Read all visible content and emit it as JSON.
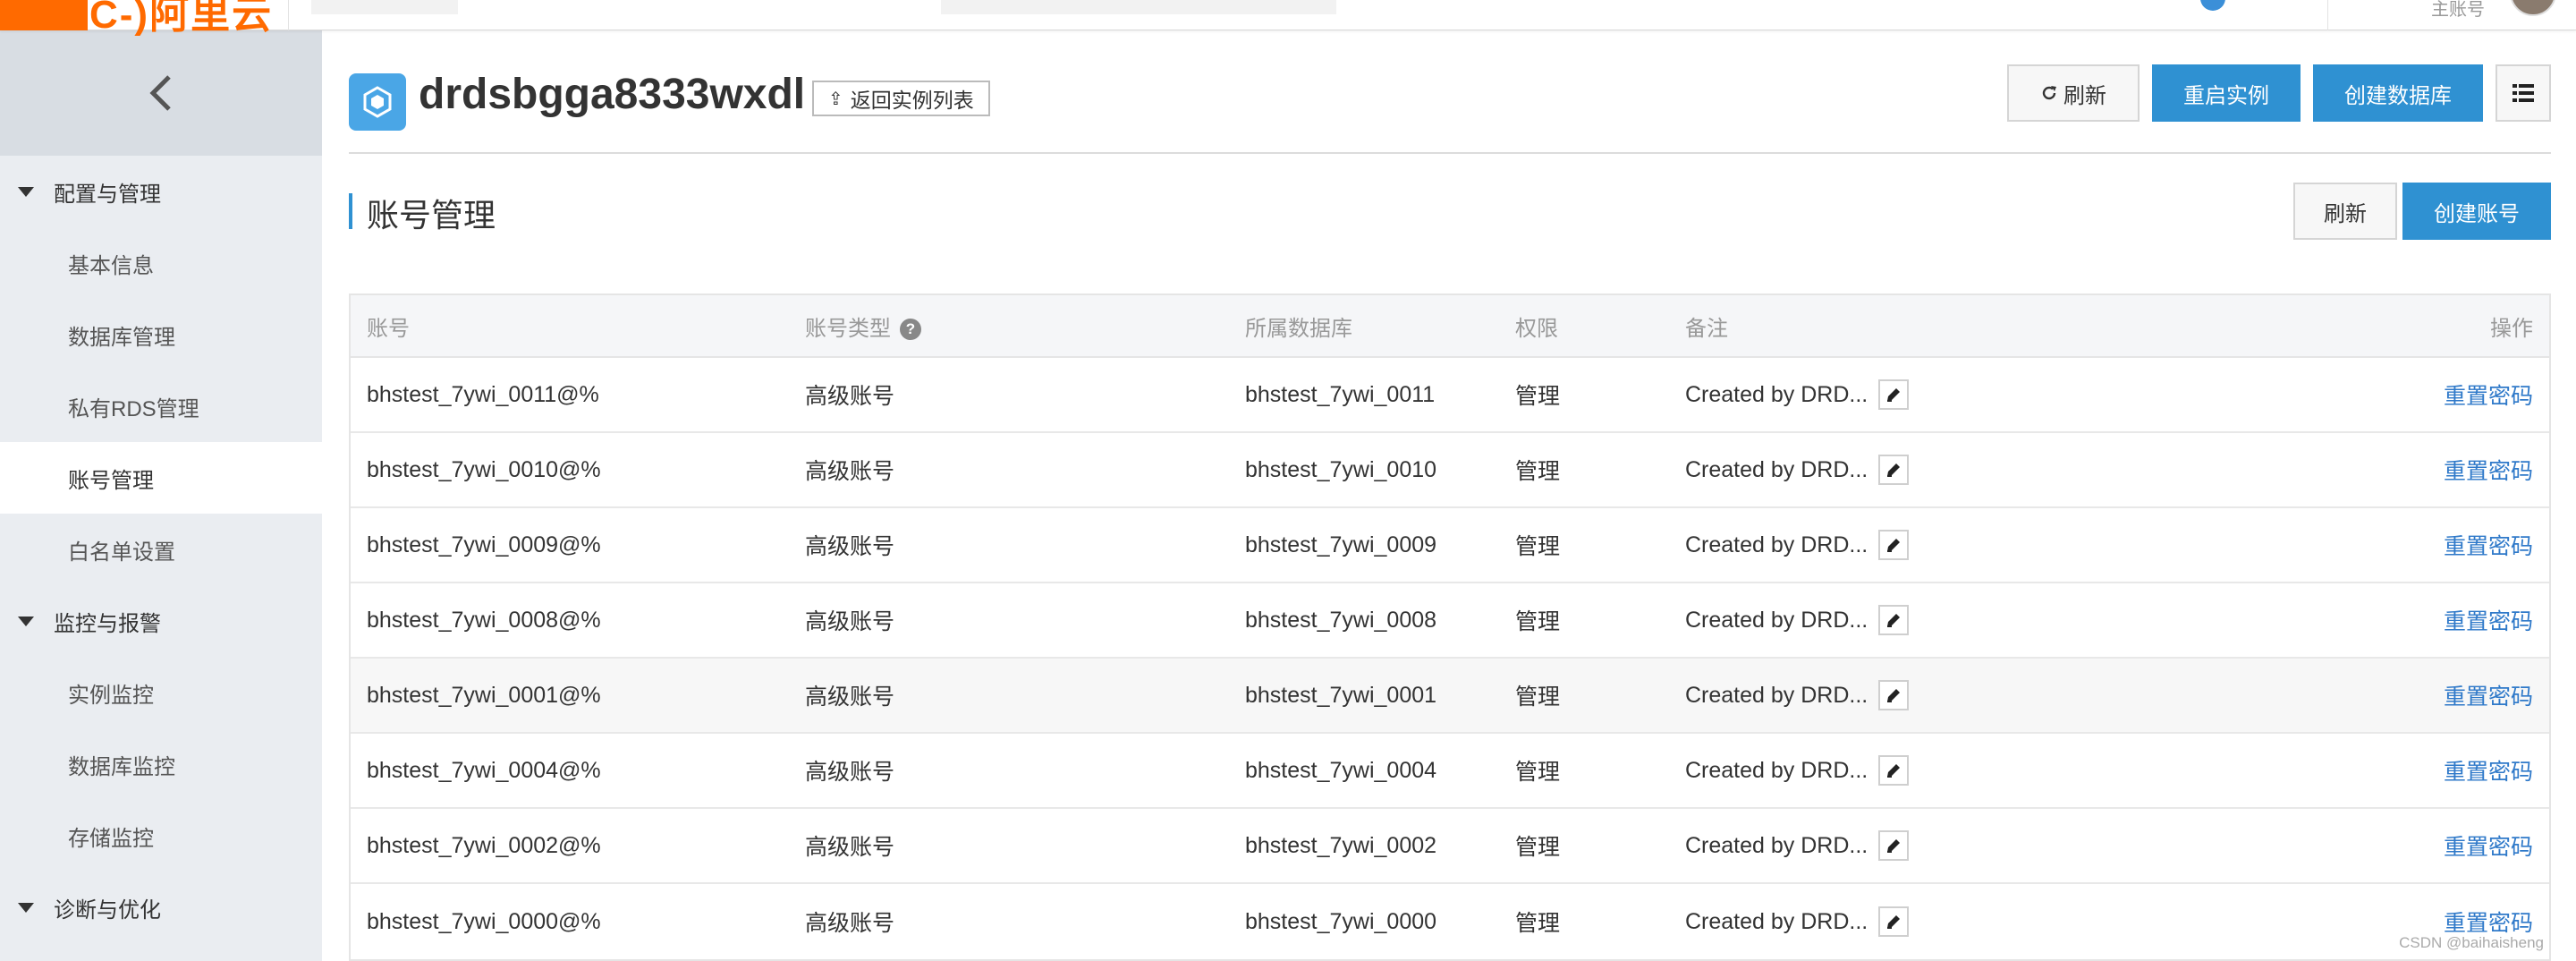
{
  "topbar": {
    "logo_text": "C-)阿里云",
    "user_label": "主账号"
  },
  "sidebar": {
    "collapse_icon": "chevron-left-icon",
    "groups": [
      {
        "label": "配置与管理",
        "items": [
          {
            "label": "基本信息"
          },
          {
            "label": "数据库管理"
          },
          {
            "label": "私有RDS管理"
          },
          {
            "label": "账号管理",
            "active": true
          },
          {
            "label": "白名单设置"
          }
        ]
      },
      {
        "label": "监控与报警",
        "items": [
          {
            "label": "实例监控"
          },
          {
            "label": "数据库监控"
          },
          {
            "label": "存储监控"
          }
        ]
      },
      {
        "label": "诊断与优化",
        "items": []
      }
    ]
  },
  "header": {
    "instance_name": "drdsbgga8333wxdl",
    "back_label": "返回实例列表",
    "refresh_label": "刷新",
    "restart_label": "重启实例",
    "create_db_label": "创建数据库",
    "menu_icon": "list-icon"
  },
  "section": {
    "title": "账号管理",
    "refresh_label": "刷新",
    "create_account_label": "创建账号"
  },
  "table": {
    "columns": {
      "account": "账号",
      "type": "账号类型",
      "db": "所属数据库",
      "perm": "权限",
      "note": "备注",
      "op": "操作"
    },
    "rows": [
      {
        "account": "bhstest_7ywi_0011@%",
        "type": "高级账号",
        "db": "bhstest_7ywi_0011",
        "perm": "管理",
        "note": "Created by DRD...",
        "op": "重置密码"
      },
      {
        "account": "bhstest_7ywi_0010@%",
        "type": "高级账号",
        "db": "bhstest_7ywi_0010",
        "perm": "管理",
        "note": "Created by DRD...",
        "op": "重置密码"
      },
      {
        "account": "bhstest_7ywi_0009@%",
        "type": "高级账号",
        "db": "bhstest_7ywi_0009",
        "perm": "管理",
        "note": "Created by DRD...",
        "op": "重置密码"
      },
      {
        "account": "bhstest_7ywi_0008@%",
        "type": "高级账号",
        "db": "bhstest_7ywi_0008",
        "perm": "管理",
        "note": "Created by DRD...",
        "op": "重置密码"
      },
      {
        "account": "bhstest_7ywi_0001@%",
        "type": "高级账号",
        "db": "bhstest_7ywi_0001",
        "perm": "管理",
        "note": "Created by DRD...",
        "op": "重置密码"
      },
      {
        "account": "bhstest_7ywi_0004@%",
        "type": "高级账号",
        "db": "bhstest_7ywi_0004",
        "perm": "管理",
        "note": "Created by DRD...",
        "op": "重置密码"
      },
      {
        "account": "bhstest_7ywi_0002@%",
        "type": "高级账号",
        "db": "bhstest_7ywi_0002",
        "perm": "管理",
        "note": "Created by DRD...",
        "op": "重置密码"
      },
      {
        "account": "bhstest_7ywi_0000@%",
        "type": "高级账号",
        "db": "bhstest_7ywi_0000",
        "perm": "管理",
        "note": "Created by DRD...",
        "op": "重置密码"
      }
    ]
  },
  "watermark": "CSDN @baihaisheng",
  "colors": {
    "brand_orange": "#ff6a00",
    "primary_blue": "#2f91d2",
    "link_blue": "#2f79c9",
    "sidebar_bg": "#eaedf1"
  }
}
